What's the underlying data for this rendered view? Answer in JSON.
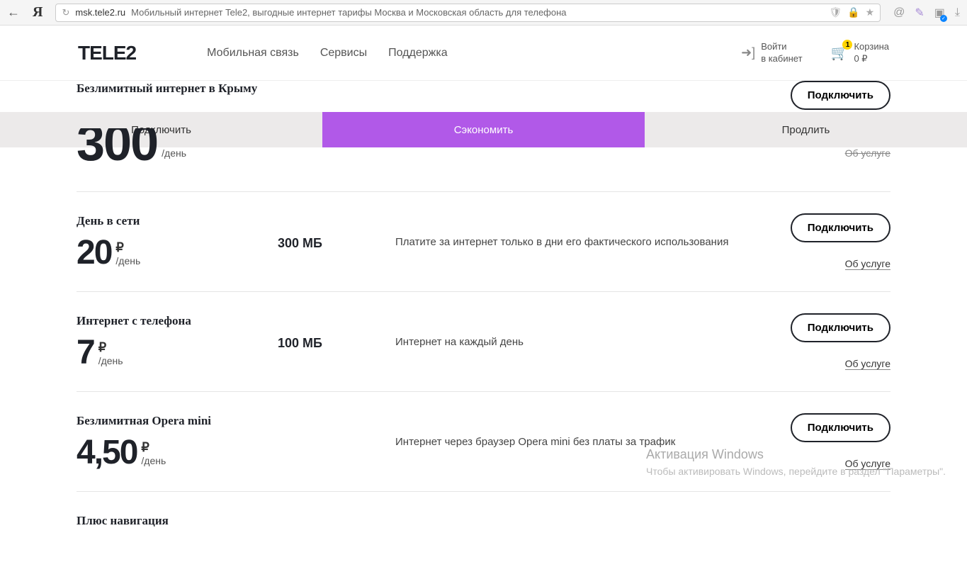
{
  "browser": {
    "url_domain": "msk.tele2.ru",
    "page_title": "Мобильный интернет Tele2, выгодные интернет тарифы Москва и Московская область для телефона"
  },
  "header": {
    "logo": "TELE2",
    "nav": [
      "Мобильная связь",
      "Сервисы",
      "Поддержка"
    ],
    "login_line1": "Войти",
    "login_line2": "в кабинет",
    "cart_label": "Корзина",
    "cart_price": "0 ₽",
    "cart_badge": "1"
  },
  "subnav": {
    "tabs": [
      "Подключить",
      "Сэкономить",
      "Продлить"
    ],
    "active_index": 1
  },
  "tariffs": [
    {
      "title": "Безлимитный интернет в Крыму",
      "price": "300",
      "period": "/день",
      "volume": "",
      "desc": "",
      "connect": "Подключить",
      "about": "Об услуге"
    },
    {
      "title": "День в сети",
      "price": "20",
      "period": "/день",
      "volume": "300 МБ",
      "desc": "Платите за интернет только в дни его фактического использования",
      "connect": "Подключить",
      "about": "Об услуге"
    },
    {
      "title": "Интернет с телефона",
      "price": "7",
      "period": "/день",
      "volume": "100 МБ",
      "desc": "Интернет на каждый день",
      "connect": "Подключить",
      "about": "Об услуге"
    },
    {
      "title": "Безлимитная Opera mini",
      "price": "4,50",
      "period": "/день",
      "volume": "",
      "desc": "Интернет через браузер Opera mini без платы за трафик",
      "connect": "Подключить",
      "about": "Об услуге"
    },
    {
      "title": "Плюс навигация",
      "price": "",
      "period": "",
      "volume": "",
      "desc": "",
      "connect": "",
      "about": ""
    }
  ],
  "watermark": {
    "title": "Активация Windows",
    "line": "Чтобы активировать Windows, перейдите в раздел \"Параметры\"."
  },
  "ruble": "₽"
}
